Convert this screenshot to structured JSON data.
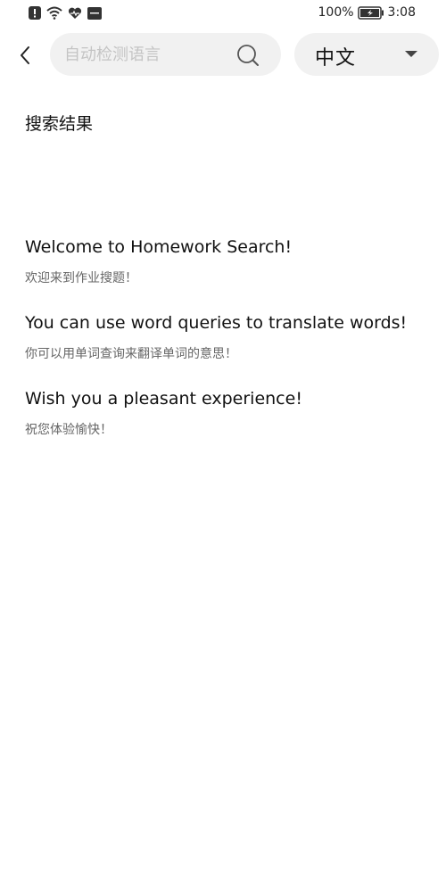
{
  "status_bar": {
    "icons": [
      "alert-icon",
      "wifi-icon",
      "heart-icon",
      "nfc-icon"
    ],
    "battery_percent": "100%",
    "time": "3:08"
  },
  "top_bar": {
    "search_placeholder": "自动检测语言",
    "search_value": "",
    "language_selected": "中文"
  },
  "section_title": "搜索结果",
  "tips": [
    {
      "en": "Welcome to Homework Search!",
      "zh": "欢迎来到作业搜题！"
    },
    {
      "en": "You can use word queries to translate words!",
      "zh": "你可以用单词查询来翻译单词的意思！"
    },
    {
      "en": "Wish you a pleasant experience!",
      "zh": "祝您体验愉快！"
    }
  ]
}
